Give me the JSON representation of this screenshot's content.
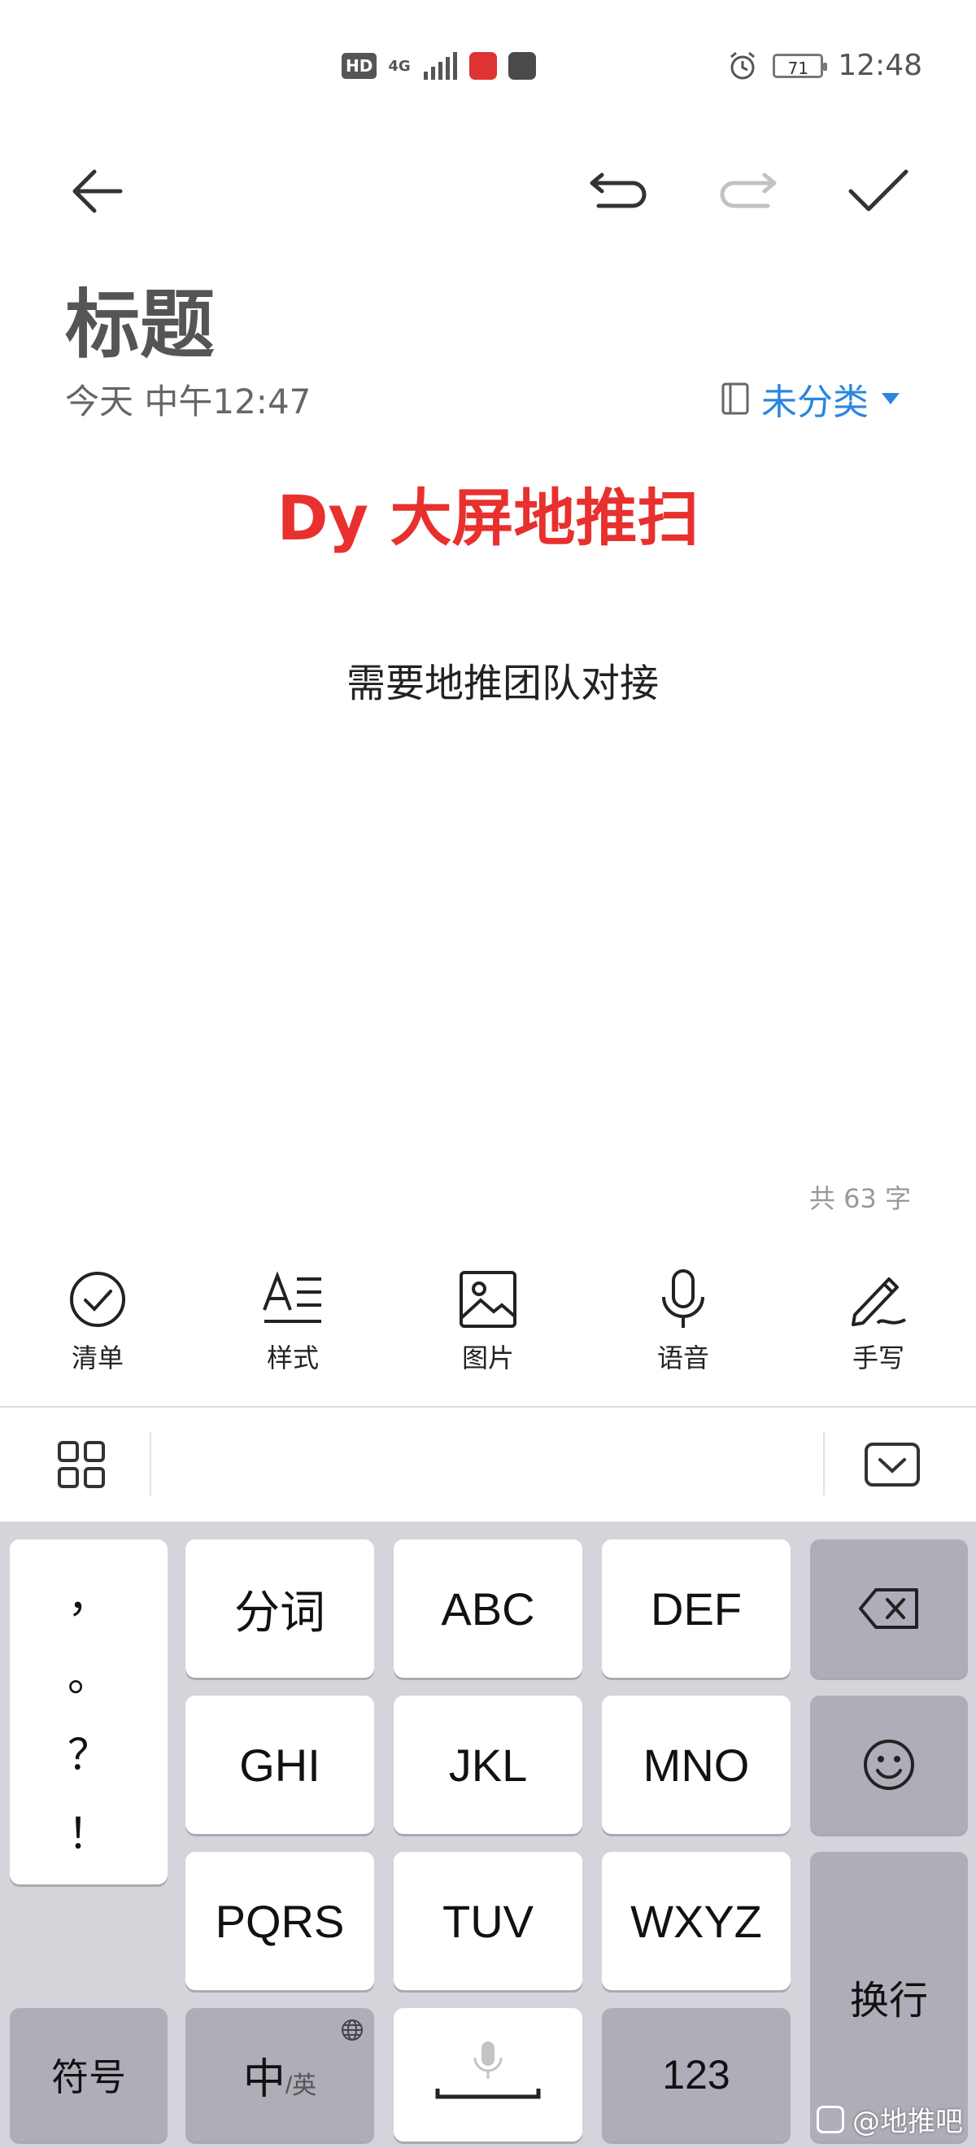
{
  "status_bar": {
    "hd": "HD",
    "network": "4G",
    "battery": "71",
    "time": "12:48"
  },
  "note": {
    "title": "标题",
    "date": "今天 中午12:47",
    "category": "未分类",
    "headline": "Dy 大屏地推扫",
    "body": "需要地推团队对接",
    "word_count": "共 63 字"
  },
  "tools": [
    {
      "label": "清单",
      "icon": "checklist-icon"
    },
    {
      "label": "样式",
      "icon": "text-style-icon"
    },
    {
      "label": "图片",
      "icon": "image-icon"
    },
    {
      "label": "语音",
      "icon": "microphone-icon"
    },
    {
      "label": "手写",
      "icon": "pen-icon"
    }
  ],
  "keyboard": {
    "punctuation": [
      "，",
      "。",
      "？",
      "！"
    ],
    "row1": [
      "分词",
      "ABC",
      "DEF"
    ],
    "row2": [
      "GHI",
      "JKL",
      "MNO"
    ],
    "row3": [
      "PQRS",
      "TUV",
      "WXYZ"
    ],
    "symbols": "符号",
    "lang_main": "中",
    "lang_alt": "/英",
    "numbers": "123",
    "enter": "换行"
  },
  "watermark": "@地推吧",
  "colors": {
    "accent_blue": "#2a86e0",
    "headline_red": "#e8302e"
  }
}
